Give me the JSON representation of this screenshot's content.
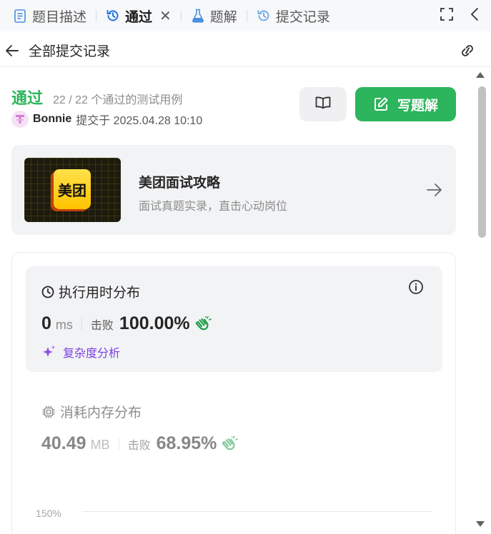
{
  "tabs": [
    {
      "label": "题目描述",
      "icon": "document-icon",
      "active": false
    },
    {
      "label": "通过",
      "icon": "history-icon",
      "active": true,
      "closable": true
    },
    {
      "label": "题解",
      "icon": "flask-icon",
      "active": false
    },
    {
      "label": "提交记录",
      "icon": "history-icon",
      "active": false
    }
  ],
  "tab_close_glyph": "✕",
  "header": {
    "title": "全部提交记录"
  },
  "submission": {
    "status": "通过",
    "cases": "22 / 22 个通过的测试用例",
    "user": "Bonnie",
    "submitted_text": "提交于 2025.04.28 10:10"
  },
  "buttons": {
    "write_solution": "写题解"
  },
  "promo": {
    "logo_text": "美团",
    "title": "美团面试攻略",
    "subtitle": "面试真题实录，直击心动岗位"
  },
  "runtime": {
    "title": "执行用时分布",
    "value": "0",
    "unit": "ms",
    "beat_label": "击败",
    "beat_value": "100.00%",
    "complexity_label": "复杂度分析"
  },
  "memory": {
    "title": "消耗内存分布",
    "value": "40.49",
    "unit": "MB",
    "beat_label": "击败",
    "beat_value": "68.95%"
  },
  "chart": {
    "top_label": "150%"
  },
  "colors": {
    "accent_green": "#2cb55c",
    "purple": "#7b3fe4",
    "tab_blue": "#1890ff"
  }
}
